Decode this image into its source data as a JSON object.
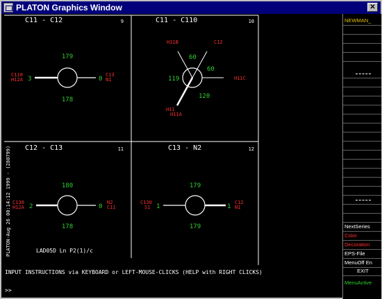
{
  "window": {
    "title": "PLATON Graphics Window",
    "close_glyph": "✕"
  },
  "panels": [
    {
      "title": "C11    - C12",
      "number": "9",
      "left_labels": [
        "C110",
        "H12A"
      ],
      "left_num": "3",
      "right_labels": [
        "C13",
        "N1"
      ],
      "right_num": "0",
      "angles": [
        "179",
        "178"
      ]
    },
    {
      "title": "C11    - C110",
      "number": "10",
      "labels": [
        "H11B",
        "C12",
        "H11C",
        "H11",
        "H11A"
      ],
      "angles": [
        "60",
        "60",
        "119",
        "120"
      ]
    },
    {
      "title": "C12    - C13",
      "number": "11",
      "left_labels": [
        "C130",
        "H12A"
      ],
      "left_num": "2",
      "right_labels": [
        "N2",
        "C11"
      ],
      "right_num": "0",
      "angles": [
        "180",
        "178"
      ]
    },
    {
      "title": "C13    - N2",
      "number": "12",
      "left_labels": [
        "C130",
        "S1"
      ],
      "left_num": "1",
      "right_labels": [
        "C12",
        "N1"
      ],
      "right_num": "1",
      "angles": [
        "179",
        "179"
      ]
    }
  ],
  "side_text": "PLATON-Aug 26 00:14:12 1999 - (280799)",
  "compound_label": "LAD05D Ln P2(1)/c",
  "instructions": "INPUT INSTRUCTIONS via KEYBOARD or LEFT-MOUSE-CLICKS (HELP with RIGHT CLICKS)",
  "prompt": ">>",
  "menu": {
    "header": "NEWMAN_",
    "items": [
      {
        "label": "NextSeries",
        "color": "white"
      },
      {
        "label": "Color",
        "color": "red"
      },
      {
        "label": "Decoration",
        "color": "red"
      },
      {
        "label": "EPS-File",
        "color": "white"
      },
      {
        "label": "MenuOff En",
        "color": "white"
      },
      {
        "label": "EXIT",
        "color": "white"
      },
      {
        "label": "MenuActive",
        "color": "green"
      }
    ]
  },
  "colors": {
    "title_bar": "#00007b",
    "label_red": "#ff3030",
    "angle_green": "#30d030",
    "bond_white": "#ffffff"
  }
}
